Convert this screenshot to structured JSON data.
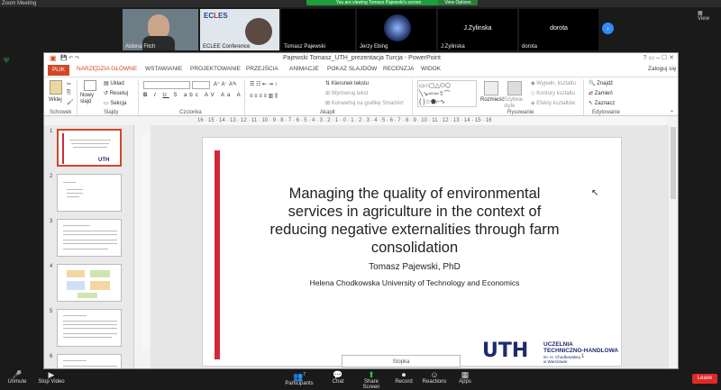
{
  "zoom": {
    "window_title": "Zoom Meeting",
    "share_banner": "You are viewing Tomasz Pajewski's screen",
    "view_options": "View Options",
    "view_label": "View",
    "participants_tiles": [
      {
        "name": "Aldona Fitch"
      },
      {
        "name": "ECLEE Conference"
      },
      {
        "name": "Tomasz Pajewski"
      },
      {
        "name": "Jerzy Ebing"
      },
      {
        "name": "J.Zylinska",
        "display": "J.Zylinska"
      },
      {
        "name": "dorota",
        "display": "dorota"
      }
    ],
    "toolbar": {
      "unmute": "Unmute",
      "stop_video": "Stop Video",
      "participants": "Participants",
      "participants_count": "7",
      "chat": "Chat",
      "share_screen": "Share Screen",
      "record": "Record",
      "reactions": "Reactions",
      "apps": "Apps",
      "leave": "Leave"
    }
  },
  "ppt": {
    "title": "Pajewski Tomasz_UTH_prezentacja Turcja - PowerPoint",
    "login": "Zaloguj się",
    "tabs": [
      "PLIK",
      "NARZĘDZIA GŁÓWNE",
      "WSTAWIANIE",
      "PROJEKTOWANIE",
      "PRZEJŚCIA",
      "ANIMACJE",
      "POKAZ SLAJDÓW",
      "RECENZJA",
      "WIDOK"
    ],
    "ribbon": {
      "paste": "Wklej",
      "clipboard": "Schowek",
      "new_slide": "Nowy slajd",
      "layout": "Układ",
      "reset": "Resetuj",
      "section": "Sekcja",
      "slides": "Slajdy",
      "font": "Czcionka",
      "text_direction": "Kierunek tekstu",
      "align_text": "Wyrównaj tekst",
      "smartart": "Konwertuj na grafikę SmartArt",
      "paragraph": "Akapit",
      "arrange": "Rozmieść",
      "quick_styles": "Szybkie style",
      "shape_fill": "Wypełn. kształtu",
      "shape_outline": "Kontury kształtu",
      "shape_effects": "Efekty kształtów",
      "drawing": "Rysowanie",
      "find": "Znajdź",
      "replace": "Zamień",
      "select": "Zaznacz",
      "editing": "Edytowanie"
    },
    "ruler_text": "16 · 15 · 14 · 13 · 12 · 11 · 10 · 9 · 8 · 7 · 6 · 5 · 4 · 3 · 2 · 1 · 0 · 1 · 2 · 3 · 4 · 5 · 6 · 7 · 8 · 9 · 10 · 11 · 12 · 13 · 14 · 15 · 16",
    "thumbnails": [
      "1",
      "2",
      "3",
      "4",
      "5",
      "6"
    ],
    "slide": {
      "title": "Managing the quality of environmental services in agriculture in the context of reducing negative externalities through farm consolidation",
      "author": "Tomasz Pajewski, PhD",
      "affiliation": "Helena Chodkowska University of Technology and Economics",
      "logo": "UTH",
      "logo_text_1": "UCZELNIA",
      "logo_text_2": "TECHNICZNO-HANDLOWA",
      "logo_text_3": "im. H. Chodkowskiej",
      "logo_text_4": "w Warszawie",
      "footer": "Stopka",
      "page": "1"
    }
  }
}
